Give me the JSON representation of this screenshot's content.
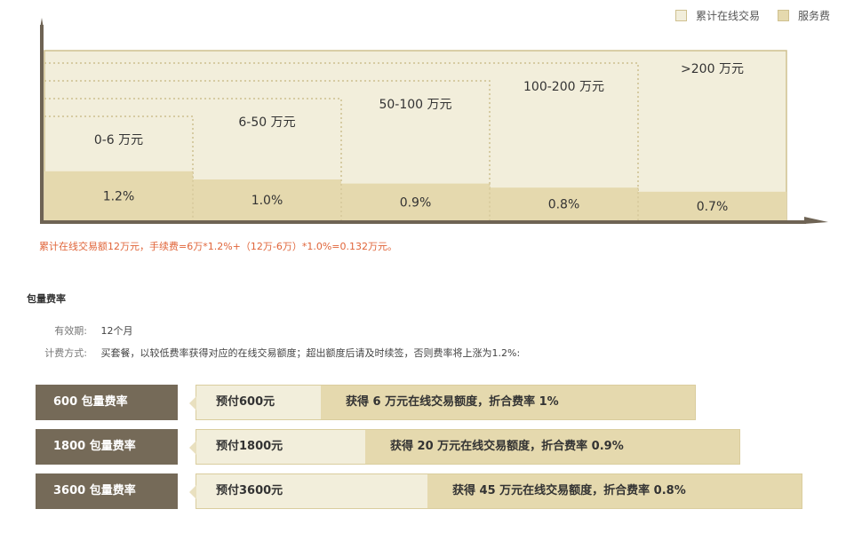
{
  "legend": [
    {
      "label": "累计在线交易",
      "color": "#f2eedb"
    },
    {
      "label": "服务费",
      "color": "#e5d9ae"
    }
  ],
  "chart_data": {
    "type": "bar",
    "title": "",
    "categories": [
      "0-6 万元",
      "6-50 万元",
      "50-100 万元",
      "100-200 万元",
      ">200 万元"
    ],
    "series": [
      {
        "name": "服务费",
        "values": [
          1.2,
          1.0,
          0.9,
          0.8,
          0.7
        ],
        "labels": [
          "1.2%",
          "1.0%",
          "0.9%",
          "0.8%",
          "0.7%"
        ]
      }
    ],
    "ylim": [
      0,
      1.5
    ],
    "colors": {
      "volume": "#f2eedb",
      "fee": "#e5d9ae",
      "border": "#cfc08f",
      "axis": "#6e6354"
    }
  },
  "example_note": "累计在线交易额12万元，手续费=6万*1.2%+（12万-6万）*1.0%=0.132万元。",
  "section_title": "包量费率",
  "info": {
    "validity_label": "有效期:",
    "validity_value": "12个月",
    "billing_label": "计费方式:",
    "billing_value": "买套餐，以较低费率获得对应的在线交易额度；超出额度后请及时续签，否则费率将上涨为1.2%:"
  },
  "packages": [
    {
      "name": "600 包量费率",
      "prepay": "预付600元",
      "desc": "获得 6 万元在线交易额度，折合费率 1%",
      "quota_wan": 6
    },
    {
      "name": "1800 包量费率",
      "prepay": "预付1800元",
      "desc": "获得 20 万元在线交易额度，折合费率 0.9%",
      "quota_wan": 20
    },
    {
      "name": "3600 包量费率",
      "prepay": "预付3600元",
      "desc": "获得 45 万元在线交易额度，折合费率 0.8%",
      "quota_wan": 45
    }
  ]
}
